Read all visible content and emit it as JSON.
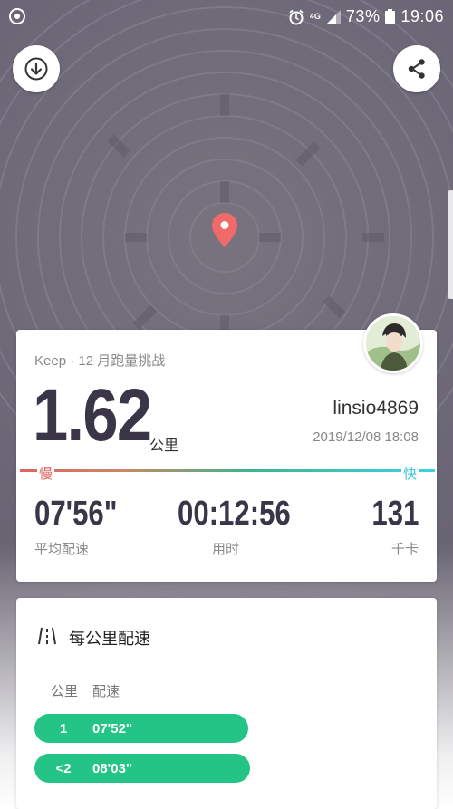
{
  "status_bar": {
    "battery_percent": "73%",
    "time": "19:06",
    "network": "4G",
    "icons": [
      "sync-icon",
      "alarm-icon",
      "signal-icon",
      "battery-icon"
    ]
  },
  "map": {
    "pin_color": "#f06a6a"
  },
  "buttons": {
    "download_icon": "download-arrow-icon",
    "share_icon": "share-icon"
  },
  "summary": {
    "challenge": "Keep · 12 月跑量挑战",
    "distance": "1.62",
    "distance_unit": "公里",
    "username": "linsio4869",
    "datetime": "2019/12/08 18:08",
    "slow_label": "慢",
    "fast_label": "快",
    "stats": {
      "avg_pace": {
        "value": "07'56\"",
        "label": "平均配速"
      },
      "duration": {
        "value": "00:12:56",
        "label": "用时"
      },
      "calories": {
        "value": "131",
        "label": "千卡"
      }
    },
    "colors": {
      "slow": "#e0635f",
      "fast": "#38d4e1",
      "number": "#3a3648"
    }
  },
  "pace_card": {
    "title": "每公里配速",
    "col_km": "公里",
    "col_pace": "配速",
    "rows": [
      {
        "km": "1",
        "pace": "07'52\"",
        "fill": 0.85
      },
      {
        "km": "<2",
        "pace": "08'03\"",
        "fill": 0.87
      }
    ],
    "bar_color": "#24c487"
  }
}
